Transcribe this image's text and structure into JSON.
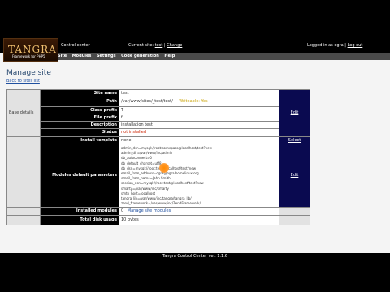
{
  "header": {
    "logo_text": "TANGRA",
    "logo_sub": "Framework for PHP5",
    "app_label": "Control center",
    "site_prefix": "Current site:",
    "current_site": "test",
    "change_link": "Change",
    "user_prefix": "Logged in as",
    "username": "ogra",
    "logout_link": "Log out"
  },
  "nav": [
    "Site",
    "Modules",
    "Settings",
    "Code generation",
    "Help"
  ],
  "page": {
    "title": "Manage site",
    "back_link": "Back to sites list"
  },
  "section": {
    "basic_details": "Base details"
  },
  "rows": {
    "site_name": {
      "label": "Site name",
      "value": "test"
    },
    "path": {
      "label": "Path",
      "value": "/var/www/sites/_test/test/",
      "note": "Writeable: Yes"
    },
    "class_prefix": {
      "label": "Class prefix",
      "value": "T"
    },
    "file_prefix": {
      "label": "File prefix",
      "value": "f"
    },
    "description": {
      "label": "Description",
      "value": "installation test"
    },
    "status": {
      "label": "Status",
      "value": "not installed"
    },
    "install_template": {
      "label": "Install template",
      "value": "none"
    },
    "module_params": {
      "label": "Modules default parameters",
      "value": "admin_dsn=mysql://root:somepass@localhost/test?new\nadmin_dir=/var/www/inc/admin\ndb_autoconnect=0\ndb_default_charset=utf8\ndb_dsn=mysql://root:test@localhost/test?new\nemail_from_address=ogra@ogra.homelinux.org\nemail_from_name=John Smith\nsession_dsn=mysql://root:test@localhost/test?new\nsmarty=/var/www/inc/smarty\nsmtp_host=localhost\ntangra_lib=/var/www/inc/tangra/tangra_lib/\nzend_framework=/var/www/inc/ZendFramework/"
    },
    "installed_modules": {
      "label": "Installed modules",
      "count": "0",
      "link": "Manage site modules"
    },
    "disk_usage": {
      "label": "Total disk usage",
      "value": "10 bytes"
    }
  },
  "actions": {
    "edit": "Edit",
    "select": "Select"
  },
  "footer": "Tangra Control Center ver. 1.1.6",
  "colors": {
    "action_bg": "#0a0a50",
    "status_red": "#cc2200",
    "note_yellow": "#c8a000"
  }
}
